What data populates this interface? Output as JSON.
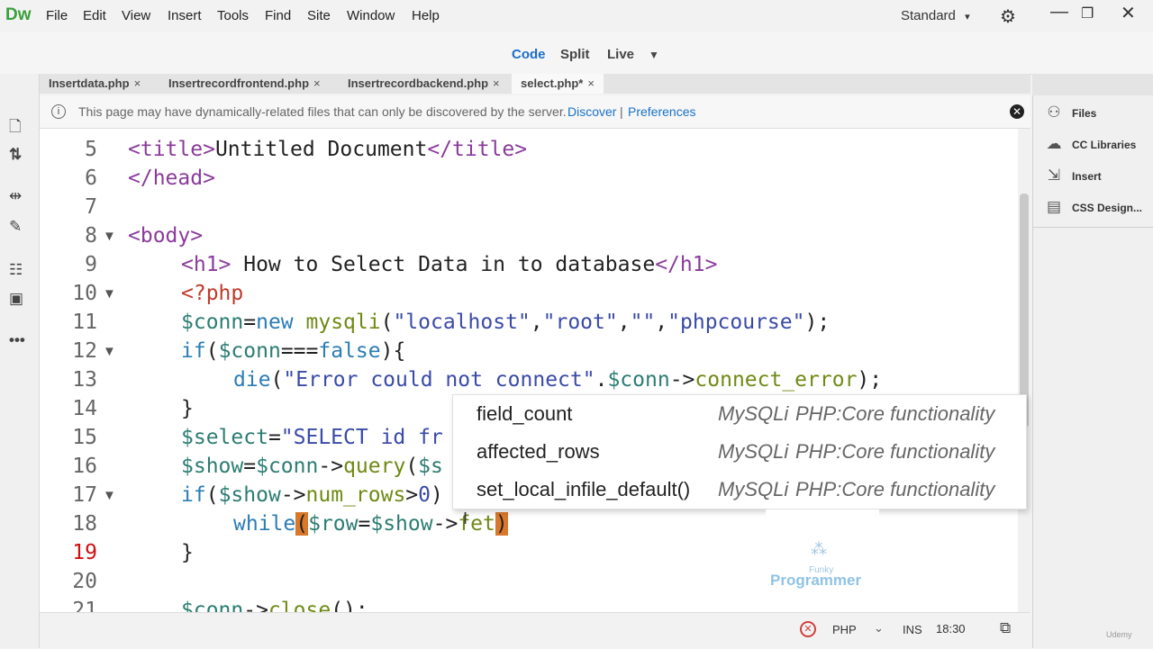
{
  "app": {
    "logo": "Dw",
    "workspace": "Standard",
    "workspace_arrow": "▾"
  },
  "menu": [
    "File",
    "Edit",
    "View",
    "Insert",
    "Tools",
    "Find",
    "Site",
    "Window",
    "Help"
  ],
  "view_modes": {
    "code": "Code",
    "split": "Split",
    "live": "Live",
    "dropdown": "▼"
  },
  "tabs": [
    {
      "label": "Insertdata.php",
      "close": "×"
    },
    {
      "label": "Insertrecordfrontend.php",
      "close": "×"
    },
    {
      "label": "Insertrecordbackend.php",
      "close": "×"
    },
    {
      "label": "select.php*",
      "close": "×"
    }
  ],
  "infobar": {
    "message": "This page may have dynamically-related files that can only be discovered by the server.",
    "discover": "Discover",
    "separator": "|",
    "preferences": "Preferences"
  },
  "code": {
    "line_numbers": [
      "5",
      "6",
      "7",
      "8",
      "9",
      "10",
      "11",
      "12",
      "13",
      "14",
      "15",
      "16",
      "17",
      "18",
      "19",
      "20",
      "21"
    ],
    "current_line": "19",
    "lines": {
      "l5": [
        "<title>",
        "Untitled Document",
        "</title>"
      ],
      "l6": [
        "</head>"
      ],
      "l8": [
        "<body>"
      ],
      "l9": [
        "<h1>",
        " How to Select Data in to database",
        "</h1>"
      ],
      "l10": [
        "<?php"
      ],
      "l11": [
        "$conn",
        "=",
        "new ",
        "mysqli",
        "(",
        "\"localhost\"",
        ",",
        "\"root\"",
        ",",
        "\"\"",
        ",",
        "\"phpcourse\"",
        ");"
      ],
      "l12": [
        "if",
        "(",
        "$conn",
        "===",
        "false",
        "){"
      ],
      "l13": [
        "die",
        "(",
        "\"Error could not connect\"",
        ".",
        "$conn",
        "->",
        "connect_error",
        ");"
      ],
      "l14": [
        "}"
      ],
      "l15": [
        "$select",
        "=",
        "\"SELECT id fr"
      ],
      "l16": [
        "$show",
        "=",
        "$conn",
        "->",
        "query",
        "(",
        "$s"
      ],
      "l17": [
        "if",
        "(",
        "$show",
        "->",
        "num_rows",
        ">",
        "0",
        ")"
      ],
      "l18": [
        "while",
        "(",
        "$row",
        "=",
        "$show",
        "->",
        "fet",
        ")"
      ],
      "l19": [
        "}"
      ],
      "l21": [
        "$conn",
        "->",
        "close",
        "();"
      ]
    }
  },
  "autocomplete": [
    {
      "name": "field_count",
      "source": "MySQLi",
      "desc": "PHP:Core functionality"
    },
    {
      "name": "affected_rows",
      "source": "MySQLi",
      "desc": "PHP:Core functionality"
    },
    {
      "name": "set_local_infile_default()",
      "source": "MySQLi",
      "desc": "PHP:Core functionality"
    }
  ],
  "watermark": {
    "small": "Funky",
    "big": "Programmer"
  },
  "right_panel": [
    {
      "label": "Files",
      "icon": "files-icon"
    },
    {
      "label": "CC Libraries",
      "icon": "cc-libraries-icon"
    },
    {
      "label": "Insert",
      "icon": "insert-icon"
    },
    {
      "label": "CSS Design...",
      "icon": "css-designer-icon"
    }
  ],
  "status": {
    "language": "PHP",
    "mode": "INS",
    "position": "18:30"
  },
  "udemy": "Udemy"
}
